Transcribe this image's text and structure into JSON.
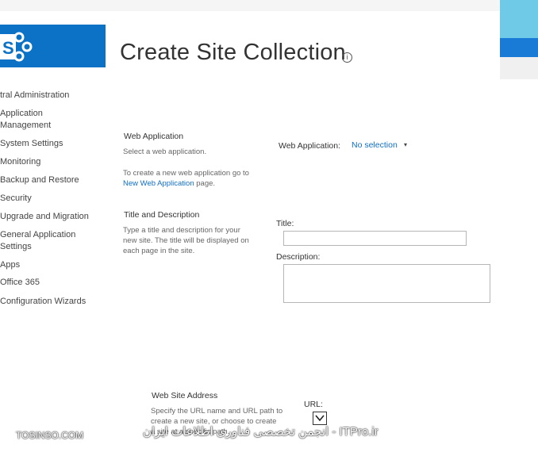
{
  "page": {
    "title": "Create Site Collection",
    "info_icon": "info-icon"
  },
  "nav": {
    "items": [
      "tral Administration",
      "Application",
      "Management",
      "System Settings",
      "Monitoring",
      "Backup and Restore",
      "Security",
      "Upgrade and Migration",
      "General Application",
      "Settings",
      "Apps",
      "Office 365",
      "Configuration Wizards"
    ]
  },
  "web_application": {
    "title": "Web Application",
    "desc": "Select a web application.",
    "create_text_1": "To create a new web application go to",
    "create_link": "New Web Application",
    "create_text_2": "page.",
    "field_label": "Web Application:",
    "selected_value": "No selection",
    "caret": "▾"
  },
  "title_description": {
    "title": "Title and Description",
    "desc_line1": "Type a title and description for your",
    "desc_line2": "new site. The title will be displayed on",
    "desc_line3": "each page in the site.",
    "title_label": "Title:",
    "title_value": "",
    "description_label": "Description:",
    "description_value": ""
  },
  "website_address": {
    "title": "Web Site Address",
    "desc_line1": "Specify the URL name and URL path to",
    "desc_line2": "create a new site, or choose to create",
    "desc_line3": "a site at a specific path.",
    "url_label": "URL:"
  },
  "watermarks": {
    "left": "TOSINSO.COM",
    "center": "انجمن تخصصی فناوری اطلاعات ایران - ITPro.ir"
  },
  "colors": {
    "brand_blue": "#0b72c5",
    "link_blue": "#0f6fc6"
  }
}
